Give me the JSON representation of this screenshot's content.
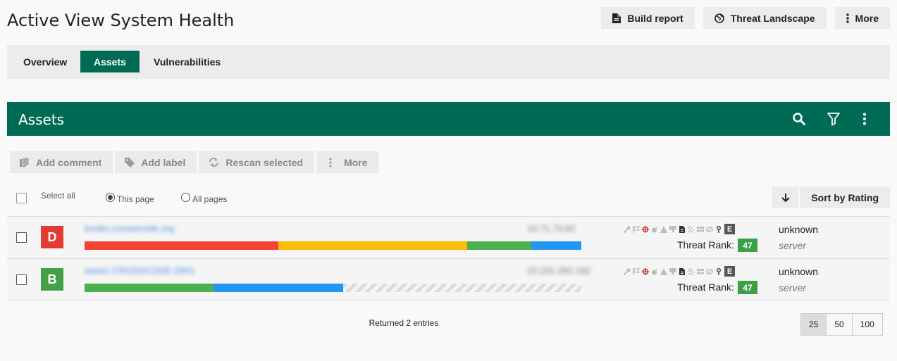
{
  "page": {
    "title": "Active View System Health"
  },
  "top_actions": {
    "build_report": "Build report",
    "threat_landscape": "Threat Landscape",
    "more": "More"
  },
  "tabs": [
    {
      "label": "Overview",
      "active": false
    },
    {
      "label": "Assets",
      "active": true
    },
    {
      "label": "Vulnerabilities",
      "active": false
    }
  ],
  "panel": {
    "title": "Assets",
    "icons": [
      "search-icon",
      "filter-icon",
      "kebab-menu-icon"
    ]
  },
  "toolbar": {
    "add_comment": "Add comment",
    "add_label": "Add label",
    "rescan_selected": "Rescan selected",
    "more": "More"
  },
  "selection": {
    "select_all": "Select all",
    "this_page": "This page",
    "all_pages": "All pages",
    "scope_selected": "This page"
  },
  "sort": {
    "direction_icon": "arrow-down-icon",
    "label": "Sort by Rating"
  },
  "assets": [
    {
      "grade": "D",
      "grade_color": "#e53935",
      "hostname": "books.crossecode.org",
      "ip": "10.71.73.82",
      "rating_bar": [
        {
          "color": "#f44336",
          "fraction": 0.39
        },
        {
          "color": "#fbbc05",
          "fraction": 0.38
        },
        {
          "color": "#4caf50",
          "fraction": 0.13
        },
        {
          "color": "#2196f3",
          "fraction": 0.1
        }
      ],
      "threat_rank_label": "Threat Rank:",
      "threat_rank": "47",
      "status": "unknown",
      "type": "server",
      "extra_badge": "E"
    },
    {
      "grade": "B",
      "grade_color": "#43a047",
      "hostname": "www1.CROSSCODE.ORG",
      "ip": "10.231.292.182",
      "rating_bar": [
        {
          "color": "#4caf50",
          "fraction": 0.26
        },
        {
          "color": "#2196f3",
          "fraction": 0.26
        },
        {
          "color": "hatch",
          "fraction": 0.48
        }
      ],
      "threat_rank_label": "Threat Rank:",
      "threat_rank": "47",
      "status": "unknown",
      "type": "server",
      "extra_badge": "E"
    }
  ],
  "footer": {
    "returned": "Returned 2 entries",
    "page_sizes": [
      "25",
      "50",
      "100"
    ],
    "active_page_size": "25"
  }
}
